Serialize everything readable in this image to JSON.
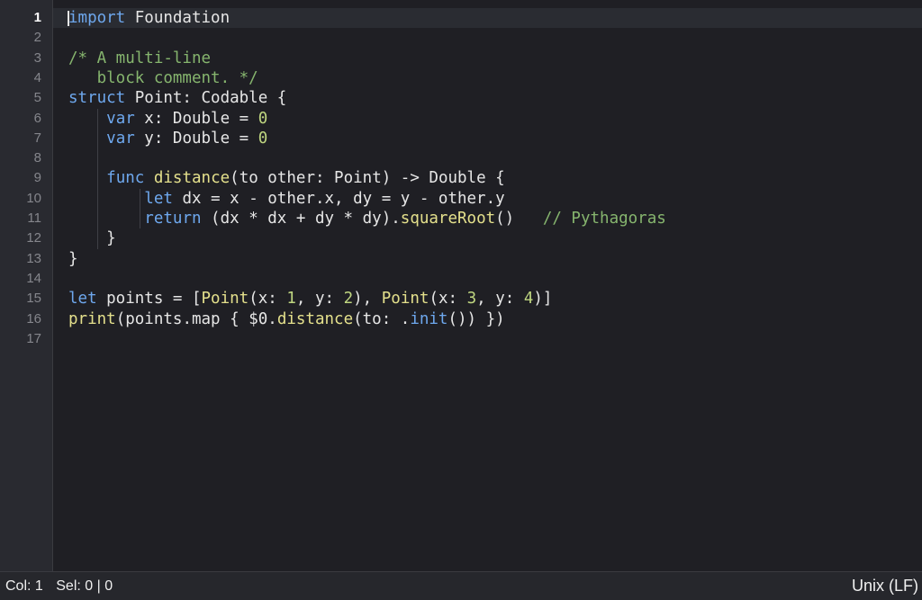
{
  "editor": {
    "lines": [
      {
        "num": "1",
        "tokens": [
          {
            "t": "import",
            "c": "kw"
          },
          {
            "t": " Foundation",
            "c": "plain"
          }
        ]
      },
      {
        "num": "2",
        "tokens": []
      },
      {
        "num": "3",
        "tokens": [
          {
            "t": "/* A multi-line",
            "c": "comment"
          }
        ]
      },
      {
        "num": "4",
        "tokens": [
          {
            "t": "   block comment. */",
            "c": "comment"
          }
        ]
      },
      {
        "num": "5",
        "tokens": [
          {
            "t": "struct",
            "c": "kw"
          },
          {
            "t": " Point: Codable {",
            "c": "plain"
          }
        ]
      },
      {
        "num": "6",
        "tokens": [
          {
            "t": "    ",
            "c": "plain"
          },
          {
            "t": "var",
            "c": "kw"
          },
          {
            "t": " x: Double = ",
            "c": "plain"
          },
          {
            "t": "0",
            "c": "num"
          }
        ]
      },
      {
        "num": "7",
        "tokens": [
          {
            "t": "    ",
            "c": "plain"
          },
          {
            "t": "var",
            "c": "kw"
          },
          {
            "t": " y: Double = ",
            "c": "plain"
          },
          {
            "t": "0",
            "c": "num"
          }
        ]
      },
      {
        "num": "8",
        "tokens": []
      },
      {
        "num": "9",
        "tokens": [
          {
            "t": "    ",
            "c": "plain"
          },
          {
            "t": "func",
            "c": "kw"
          },
          {
            "t": " ",
            "c": "plain"
          },
          {
            "t": "distance",
            "c": "fn"
          },
          {
            "t": "(to other: Point) -> Double {",
            "c": "plain"
          }
        ]
      },
      {
        "num": "10",
        "tokens": [
          {
            "t": "        ",
            "c": "plain"
          },
          {
            "t": "let",
            "c": "kw"
          },
          {
            "t": " dx = x - other.x, dy = y - other.y",
            "c": "plain"
          }
        ]
      },
      {
        "num": "11",
        "tokens": [
          {
            "t": "        ",
            "c": "plain"
          },
          {
            "t": "return",
            "c": "kw"
          },
          {
            "t": " (dx * dx + dy * dy).",
            "c": "plain"
          },
          {
            "t": "squareRoot",
            "c": "fn"
          },
          {
            "t": "()   ",
            "c": "plain"
          },
          {
            "t": "// Pythagoras",
            "c": "comment"
          }
        ]
      },
      {
        "num": "12",
        "tokens": [
          {
            "t": "    }",
            "c": "plain"
          }
        ]
      },
      {
        "num": "13",
        "tokens": [
          {
            "t": "}",
            "c": "plain"
          }
        ]
      },
      {
        "num": "14",
        "tokens": []
      },
      {
        "num": "15",
        "tokens": [
          {
            "t": "let",
            "c": "kw"
          },
          {
            "t": " points = [",
            "c": "plain"
          },
          {
            "t": "Point",
            "c": "fn"
          },
          {
            "t": "(x: ",
            "c": "plain"
          },
          {
            "t": "1",
            "c": "num"
          },
          {
            "t": ", y: ",
            "c": "plain"
          },
          {
            "t": "2",
            "c": "num"
          },
          {
            "t": "), ",
            "c": "plain"
          },
          {
            "t": "Point",
            "c": "fn"
          },
          {
            "t": "(x: ",
            "c": "plain"
          },
          {
            "t": "3",
            "c": "num"
          },
          {
            "t": ", y: ",
            "c": "plain"
          },
          {
            "t": "4",
            "c": "num"
          },
          {
            "t": ")]",
            "c": "plain"
          }
        ]
      },
      {
        "num": "16",
        "tokens": [
          {
            "t": "print",
            "c": "fn"
          },
          {
            "t": "(points.map { $0.",
            "c": "plain"
          },
          {
            "t": "distance",
            "c": "fn"
          },
          {
            "t": "(to: .",
            "c": "plain"
          },
          {
            "t": "init",
            "c": "kw"
          },
          {
            "t": "()) })",
            "c": "plain"
          }
        ]
      },
      {
        "num": "17",
        "tokens": []
      }
    ],
    "current_line": 1
  },
  "statusbar": {
    "col": "Col: 1",
    "sel": "Sel: 0 | 0",
    "line_ending": "Unix (LF)"
  },
  "colors": {
    "kw": "#6ea8ee",
    "plain": "#e6e6e6",
    "comment": "#86b56e",
    "num": "#bfd680",
    "fn": "#e4e08c"
  }
}
